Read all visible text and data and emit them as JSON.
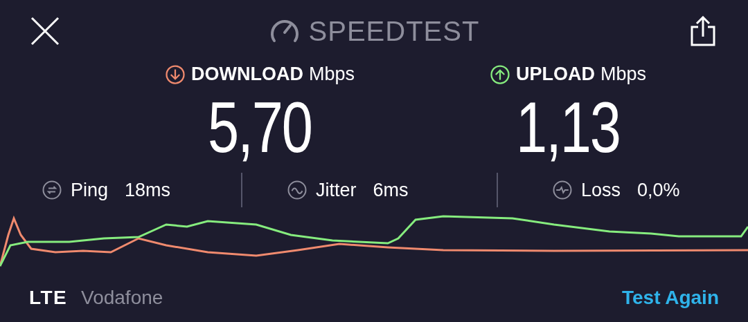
{
  "header": {
    "title": "SPEEDTEST"
  },
  "results": [
    {
      "kind": "download",
      "label": "DOWNLOAD",
      "unit": "Mbps",
      "value": "5,70",
      "color": "#f08a6e"
    },
    {
      "kind": "upload",
      "label": "UPLOAD",
      "unit": "Mbps",
      "value": "1,13",
      "color": "#86ec7e"
    }
  ],
  "stats": [
    {
      "kind": "ping",
      "label": "Ping",
      "value": "18ms"
    },
    {
      "kind": "jitter",
      "label": "Jitter",
      "value": "6ms"
    },
    {
      "kind": "loss",
      "label": "Loss",
      "value": "0,0%"
    }
  ],
  "network": {
    "type": "LTE",
    "carrier": "Vodafone"
  },
  "action": "Test Again"
}
